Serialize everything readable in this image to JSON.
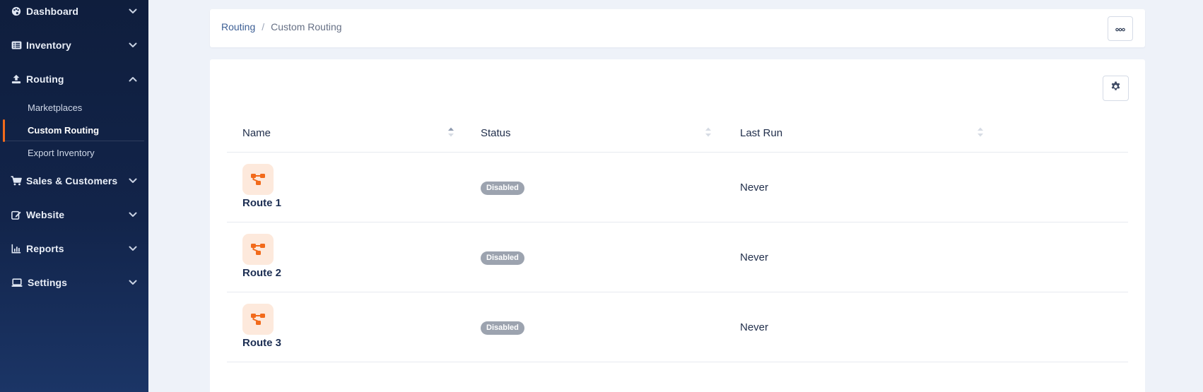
{
  "sidebar": {
    "items": [
      {
        "label": "Dashboard",
        "icon": "palette-icon"
      },
      {
        "label": "Inventory",
        "icon": "list-icon"
      },
      {
        "label": "Routing",
        "icon": "upload-icon",
        "expanded": true,
        "children": [
          {
            "label": "Marketplaces"
          },
          {
            "label": "Custom Routing",
            "active": true
          },
          {
            "label": "Export Inventory"
          }
        ]
      },
      {
        "label": "Sales & Customers",
        "icon": "cart-icon"
      },
      {
        "label": "Website",
        "icon": "edit-icon"
      },
      {
        "label": "Reports",
        "icon": "chart-icon"
      },
      {
        "label": "Settings",
        "icon": "laptop-icon"
      }
    ]
  },
  "breadcrumb": {
    "parent": "Routing",
    "separator": "/",
    "current": "Custom Routing"
  },
  "table": {
    "columns": [
      "Name",
      "Status",
      "Last Run"
    ],
    "rows": [
      {
        "name": "Route 1",
        "status": "Disabled",
        "last_run": "Never"
      },
      {
        "name": "Route 2",
        "status": "Disabled",
        "last_run": "Never"
      },
      {
        "name": "Route 3",
        "status": "Disabled",
        "last_run": "Never"
      }
    ]
  },
  "colors": {
    "sidebar_bg": "#12244a",
    "accent": "#f26a1b",
    "badge_disabled": "#9ca3af",
    "route_icon_bg": "#fde9dc"
  }
}
